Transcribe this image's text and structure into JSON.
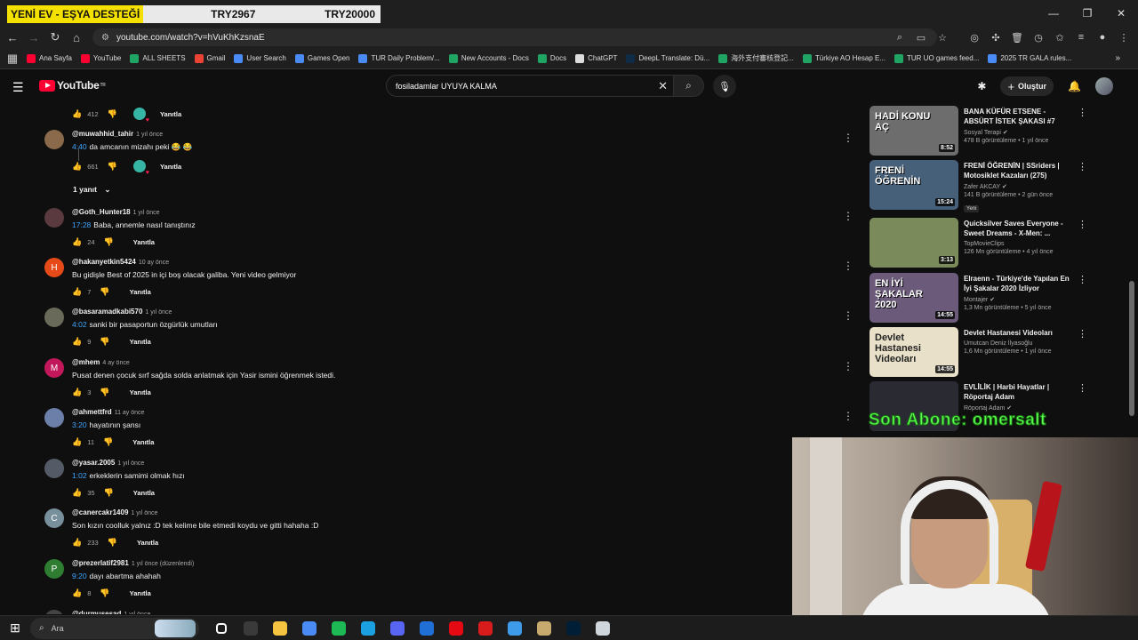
{
  "stream_bar": {
    "highlight": "YENİ EV - EŞYA DESTEĞİ",
    "mid": "TRY2967",
    "right": "TRY20000"
  },
  "browser": {
    "url": "youtube.com/watch?v=hVuKhKzsnaE",
    "bookmarks": [
      {
        "label": "Ana Sayfa",
        "color": "#ff0033"
      },
      {
        "label": "YouTube",
        "color": "#ff0033"
      },
      {
        "label": "ALL SHEETS",
        "color": "#1fa463"
      },
      {
        "label": "Gmail",
        "color": "#ea4335"
      },
      {
        "label": "User Search",
        "color": "#4a8af4"
      },
      {
        "label": "Games Open",
        "color": "#4a8af4"
      },
      {
        "label": "TUR Daily Problem/...",
        "color": "#4a8af4"
      },
      {
        "label": "New Accounts - Docs",
        "color": "#1fa463"
      },
      {
        "label": "Docs",
        "color": "#1fa463"
      },
      {
        "label": "ChatGPT",
        "color": "#dddddd"
      },
      {
        "label": "DeepL Translate: Dü...",
        "color": "#0f2b46"
      },
      {
        "label": "海外支付審核登記...",
        "color": "#1fa463"
      },
      {
        "label": "Türkiye AO Hesap E...",
        "color": "#1fa463"
      },
      {
        "label": "TUR UO games feed...",
        "color": "#1fa463"
      },
      {
        "label": "2025 TR GALA rules...",
        "color": "#4a8af4"
      }
    ]
  },
  "youtube": {
    "logo": "YouTube",
    "region": "TR",
    "search_value": "fosiladamlar UYUYA KALMA",
    "create_label": "Oluştur"
  },
  "comments": {
    "reply_label": "Yanıtla",
    "top_row": {
      "likes": "412"
    },
    "items": [
      {
        "user": "@muwahhid_tahir",
        "time": "1 yıl önce",
        "ts": "4:40",
        "text": "da amcanın mizahı peki 😂 😂",
        "likes": "661",
        "heart": true,
        "avatar_color": "#8a6a4a",
        "avatar_letter": ""
      },
      {
        "user": "@Goth_Hunter18",
        "time": "1 yıl önce",
        "ts": "17:28",
        "text": "Baba, annemle nasıl tanıştınız",
        "likes": "24",
        "heart": false,
        "avatar_color": "#5a3a3e",
        "avatar_letter": ""
      },
      {
        "user": "@hakanyetkin5424",
        "time": "10 ay önce",
        "ts": "",
        "text": "Bu gidişle Best of 2025 in içi boş olacak galiba. Yeni video gelmiyor",
        "likes": "7",
        "heart": false,
        "avatar_color": "#e64a19",
        "avatar_letter": "H"
      },
      {
        "user": "@basaramadkabi570",
        "time": "1 yıl önce",
        "ts": "4:02",
        "text": "sanki bir pasaportun özgürlük umutları",
        "likes": "9",
        "heart": false,
        "avatar_color": "#6a6a5a",
        "avatar_letter": ""
      },
      {
        "user": "@mhem",
        "time": "4 ay önce",
        "ts": "",
        "text": "Pusat denen çocuk sırf sağda solda anlatmak için Yasir ismini öğrenmek istedi.",
        "likes": "3",
        "heart": false,
        "avatar_color": "#c2185b",
        "avatar_letter": "M"
      },
      {
        "user": "@ahmettfrd",
        "time": "11 ay önce",
        "ts": "3:20",
        "text": "hayatının şansı",
        "likes": "11",
        "heart": false,
        "avatar_color": "#6b7fa8",
        "avatar_letter": ""
      },
      {
        "user": "@yasar.2005",
        "time": "1 yıl önce",
        "ts": "1:02",
        "text": "erkeklerin samimi olmak hızı",
        "likes": "35",
        "heart": false,
        "avatar_color": "#555b66",
        "avatar_letter": ""
      },
      {
        "user": "@canercakr1409",
        "time": "1 yıl önce",
        "ts": "",
        "text": "Son kızın coolluk yalnız :D tek kelime bile etmedi koydu ve gitti hahaha :D",
        "likes": "233",
        "heart": false,
        "avatar_color": "#78909c",
        "avatar_letter": "C"
      },
      {
        "user": "@prezerlatif2981",
        "time": "1 yıl önce (düzenlendi)",
        "ts": "9:20",
        "text": "dayı abartma ahahah",
        "likes": "8",
        "heart": false,
        "avatar_color": "#2e7d32",
        "avatar_letter": "P"
      },
      {
        "user": "@durmusesad",
        "time": "1 yıl önce",
        "ts": "",
        "text": "",
        "likes": "",
        "heart": false,
        "avatar_color": "#444444",
        "avatar_letter": ""
      }
    ],
    "replies_toggle": "1 yanıt"
  },
  "sidebar": {
    "videos": [
      {
        "title": "BANA KÜFÜR ETSENE - ABSÜRT İSTEK ŞAKASI #7",
        "channel": "Sosyal Terapi",
        "verified": true,
        "stats": "478 B görüntüleme • 1 yıl önce",
        "duration": "8:52",
        "thumb_text": "HADİ KONU AÇ",
        "thumb_bg": "#6d6d6d",
        "new_badge": ""
      },
      {
        "title": "FRENİ ÖĞRENİN | SSriders | Motosiklet Kazaları (275)",
        "channel": "Zafer AKCAY",
        "verified": true,
        "stats": "141 B görüntüleme • 2 gün önce",
        "duration": "15:24",
        "thumb_text": "FRENİ ÖĞRENİN",
        "thumb_bg": "#47607a",
        "new_badge": "Yeni"
      },
      {
        "title": "Quicksilver Saves Everyone - Sweet Dreams - X-Men: ...",
        "channel": "TopMovieClips",
        "verified": false,
        "stats": "126 Mn görüntüleme • 4 yıl önce",
        "duration": "3:13",
        "thumb_text": "",
        "thumb_bg": "#7a8a5a",
        "new_badge": ""
      },
      {
        "title": "Elraenn - Türkiye'de Yapılan En İyi Şakalar 2020 İzliyor",
        "channel": "Montajer",
        "verified": true,
        "stats": "1,3 Mn görüntüleme • 5 yıl önce",
        "duration": "14:55",
        "thumb_text": "EN İYİ ŞAKALAR 2020",
        "thumb_bg": "#6b5a7a",
        "new_badge": ""
      },
      {
        "title": "Devlet Hastanesi Videoları",
        "channel": "Umutcan Deniz İlyasoğlu",
        "verified": false,
        "stats": "1,6 Mn görüntüleme • 1 yıl önce",
        "duration": "14:55",
        "thumb_text": "Devlet Hastanesi Videoları",
        "thumb_bg": "#e8e0c8",
        "new_badge": ""
      },
      {
        "title": "EVLİLİK | Harbi Hayatlar | Röportaj Adam",
        "channel": "Röportaj Adam",
        "verified": true,
        "stats": "",
        "duration": "",
        "thumb_text": "",
        "thumb_bg": "#2a2a32",
        "new_badge": ""
      }
    ]
  },
  "overlay": {
    "sub_text": "Son Abone: omersalt"
  },
  "taskbar": {
    "search_placeholder": "Ara",
    "apps": [
      {
        "name": "taskview-icon",
        "color": "#ffffff"
      },
      {
        "name": "obs-icon",
        "color": "#3a3a3a"
      },
      {
        "name": "explorer-icon",
        "color": "#f5c542"
      },
      {
        "name": "chrome-icon",
        "color": "#4a8af4"
      },
      {
        "name": "spotify-icon",
        "color": "#1db954"
      },
      {
        "name": "edge-icon",
        "color": "#1ba0e2"
      },
      {
        "name": "discord-icon",
        "color": "#5865f2"
      },
      {
        "name": "mail-icon",
        "color": "#1f6fd6"
      },
      {
        "name": "netflix-icon",
        "color": "#e50914"
      },
      {
        "name": "app-red-icon",
        "color": "#d81b1b"
      },
      {
        "name": "paint-icon",
        "color": "#3d9be9"
      },
      {
        "name": "league-icon",
        "color": "#c8aa6e"
      },
      {
        "name": "photoshop-icon",
        "color": "#001e36"
      },
      {
        "name": "notes-icon",
        "color": "#cfd6dc"
      }
    ]
  }
}
